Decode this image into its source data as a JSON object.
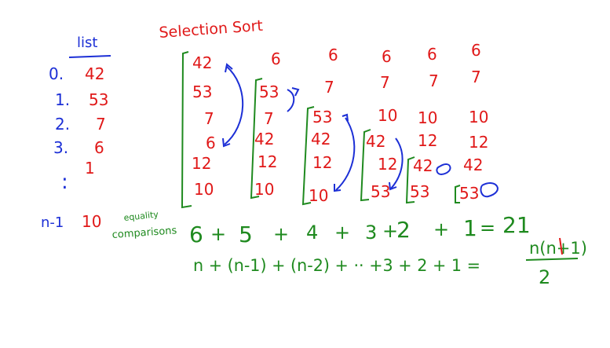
{
  "colors": {
    "blue": "#1c2fd6",
    "red": "#e01818",
    "green": "#1f8a1f",
    "black": "#000000"
  },
  "title": "Selection Sort",
  "list": {
    "heading": "list",
    "indices": [
      "0.",
      "1.",
      "2.",
      "3.",
      ":",
      "n-1"
    ],
    "values": [
      "42",
      "53",
      "7",
      "6",
      "1",
      "10"
    ]
  },
  "passes": [
    [
      "42",
      "53",
      "7",
      "6",
      "12",
      "10"
    ],
    [
      "6",
      "53",
      "7",
      "42",
      "12",
      "10"
    ],
    [
      "6",
      "7",
      "53",
      "42",
      "12",
      "10"
    ],
    [
      "6",
      "7",
      "10",
      "42",
      "12",
      "53"
    ],
    [
      "6",
      "7",
      "10",
      "12",
      "42",
      "53"
    ],
    [
      "6",
      "7",
      "10",
      "12",
      "42",
      "53"
    ]
  ],
  "equality_label_line1": "equality",
  "equality_label_line2": "comparisons",
  "sum_terms": [
    "6",
    "5",
    "4",
    "3",
    "2",
    "1"
  ],
  "sum_ops": [
    "+",
    "+",
    "+",
    "+",
    "+"
  ],
  "sum_equals": "=",
  "sum_result": "21",
  "general_sum": "n + (n-1) + (n-2) + ·· +3 + 2 + 1 =",
  "formula_numerator": "n(n+1)",
  "formula_denominator": "2"
}
